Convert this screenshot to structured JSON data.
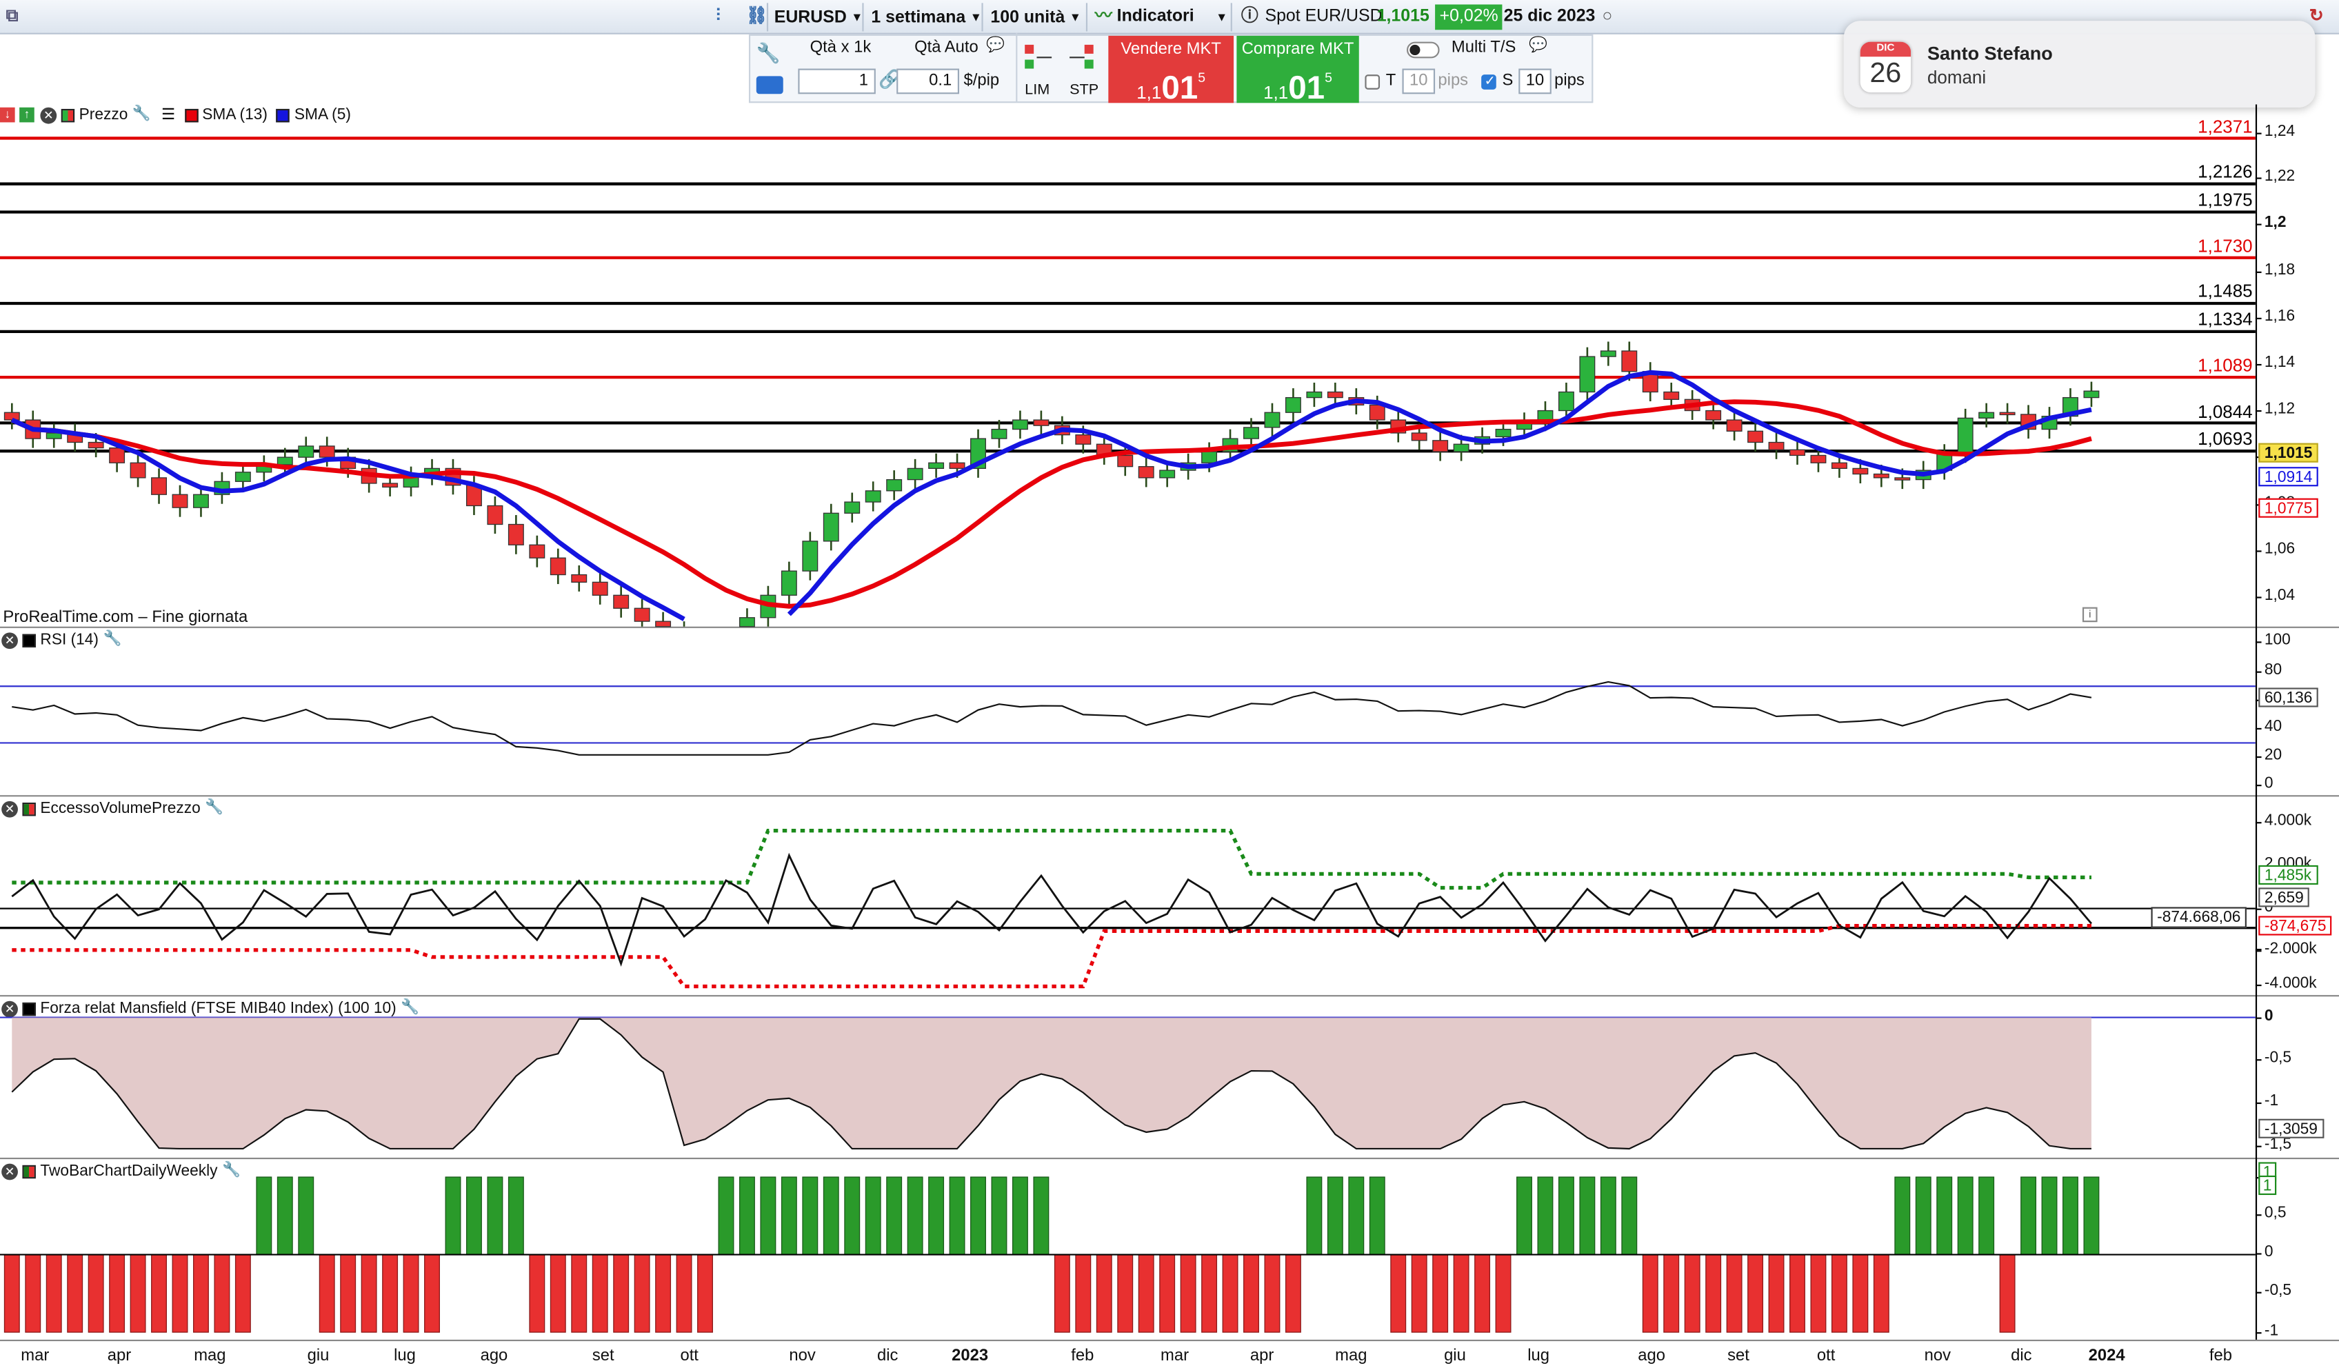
{
  "topbar": {
    "symbol": "EURUSD",
    "timeframe": "1 settimana",
    "units": "100 unità",
    "indicators_label": "Indicatori",
    "spot_label": "Spot EUR/USD",
    "spot_price": "1,1015",
    "change": "+0,02%",
    "date": "25 dic 2023"
  },
  "tradebar": {
    "qty_label": "Qtà  x 1k",
    "qty_value": "1",
    "auto_label": "Qtà Auto",
    "pip_value": "0.1",
    "pip_unit": "$/pip",
    "lim_label": "LIM",
    "stp_label": "STP",
    "sell_label": "Vendere MKT",
    "sell_price_small": "1,1",
    "sell_price_big": "01",
    "sell_price_sup": "5",
    "buy_label": "Comprare MKT",
    "buy_price_small": "1,1",
    "buy_price_big": "01",
    "buy_price_sup": "5",
    "multi_label": "Multi T/S",
    "t_label": "T",
    "t_value": "10",
    "t_unit": "pips",
    "s_label": "S",
    "s_value": "10",
    "s_unit": "pips"
  },
  "notification": {
    "month": "DIC",
    "day": "26",
    "title": "Santo Stefano",
    "subtitle": "domani"
  },
  "price_panel": {
    "legend": [
      "Prezzo",
      "SMA (13)",
      "SMA (5)"
    ],
    "watermark": "ProRealTime.com – Fine giornata",
    "axis_ticks": [
      "1,24",
      "1,22",
      "1,2",
      "1,18",
      "1,16",
      "1,14",
      "1,12",
      "1,1",
      "1,08",
      "1,06",
      "1,04"
    ],
    "level_labels": [
      {
        "value": "1,2371",
        "color": "#e00000"
      },
      {
        "value": "1,2126",
        "color": "#000000"
      },
      {
        "value": "1,1975",
        "color": "#000000"
      },
      {
        "value": "1,1730",
        "color": "#e00000"
      },
      {
        "value": "1,1485",
        "color": "#000000"
      },
      {
        "value": "1,1334",
        "color": "#000000"
      },
      {
        "value": "1,1089",
        "color": "#e00000"
      },
      {
        "value": "1,0844",
        "color": "#000000"
      },
      {
        "value": "1,0693",
        "color": "#000000"
      }
    ],
    "price_box": "1,1015",
    "sma5_box": "1,0914",
    "sma13_box": "1,0775",
    "colors": {
      "up": "#2bb33d",
      "down": "#e83030",
      "sma13": "#e8000b",
      "sma5": "#1414e0"
    }
  },
  "rsi_panel": {
    "title": "RSI (14)",
    "axis_ticks": [
      "100",
      "80",
      "60",
      "40",
      "20",
      "0"
    ],
    "value_box": "60,136"
  },
  "volume_panel": {
    "title": "EccessoVolumePrezzo",
    "axis_ticks": [
      "4.000k",
      "2.000k",
      "0",
      "-2.000k",
      "-4.000k"
    ],
    "cursor_value": "-874.668,06",
    "green_box": "1,485k",
    "black_box": "2,659",
    "red_box": "-874,675"
  },
  "mansfield_panel": {
    "title": "Forza relat Mansfield (FTSE MIB40 Index) (100 10)",
    "axis_ticks": [
      "0",
      "-0,5",
      "-1",
      "-1,5"
    ],
    "value_box": "-1,3059"
  },
  "twobar_panel": {
    "title": "TwoBarChartDailyWeekly",
    "axis_ticks": [
      "1",
      "0,5",
      "0",
      "-0,5",
      "-1"
    ],
    "value_box_1": "1",
    "value_box_2": "1"
  },
  "x_axis": [
    "mar",
    "apr",
    "mag",
    "giu",
    "lug",
    "ago",
    "set",
    "ott",
    "nov",
    "dic",
    "2023",
    "feb",
    "mar",
    "apr",
    "mag",
    "giu",
    "lug",
    "ago",
    "set",
    "ott",
    "nov",
    "dic",
    "2024",
    "feb"
  ]
}
